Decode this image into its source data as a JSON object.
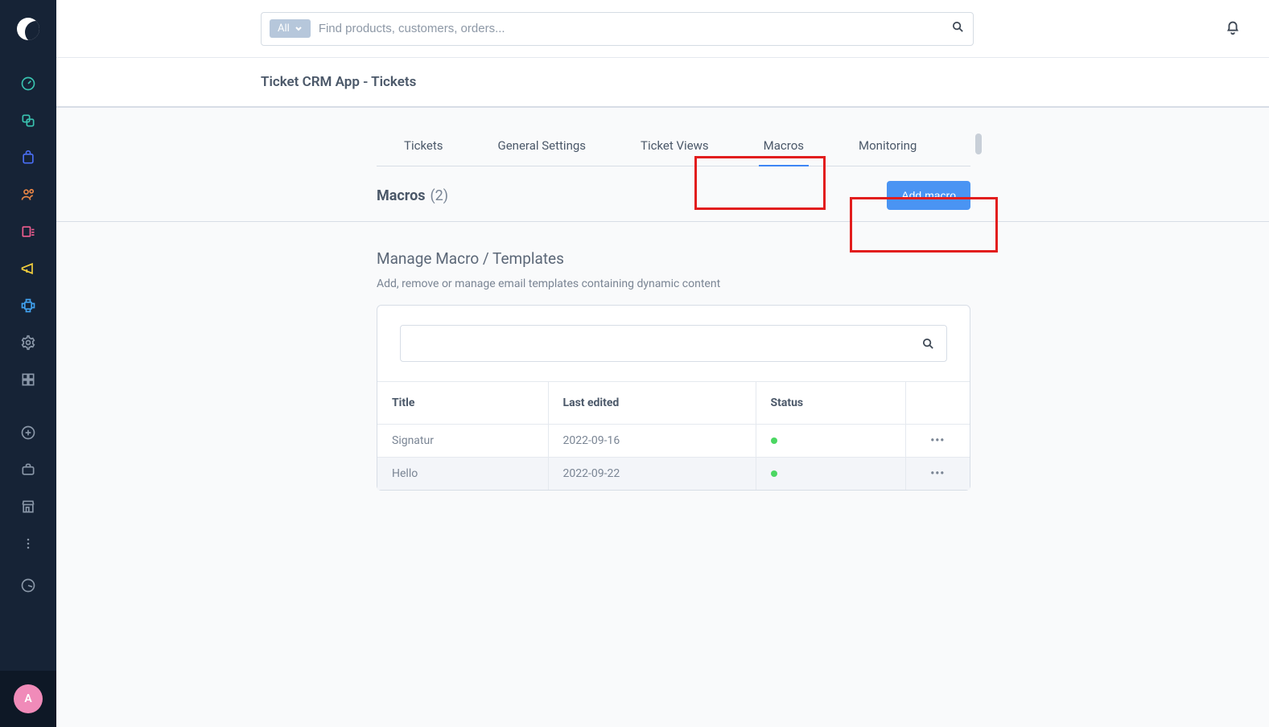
{
  "search": {
    "filter_label": "All",
    "placeholder": "Find products, customers, orders..."
  },
  "page_title": "Ticket CRM App - Tickets",
  "tabs": {
    "items": [
      {
        "label": "Tickets"
      },
      {
        "label": "General Settings"
      },
      {
        "label": "Ticket Views"
      },
      {
        "label": "Macros"
      },
      {
        "label": "Monitoring"
      }
    ],
    "active_index": 3
  },
  "subheader": {
    "title": "Macros",
    "count": "(2)",
    "add_button": "Add macro"
  },
  "section": {
    "title": "Manage Macro / Templates",
    "subtitle": "Add, remove or manage email templates containing dynamic content"
  },
  "table": {
    "columns": {
      "title": "Title",
      "last_edited": "Last edited",
      "status": "Status"
    },
    "rows": [
      {
        "title": "Signatur",
        "last_edited": "2022-09-16",
        "status": "active"
      },
      {
        "title": "Hello",
        "last_edited": "2022-09-22",
        "status": "active"
      }
    ]
  },
  "avatar_letter": "A",
  "sidebar_icons": [
    "dashboard-icon",
    "catalog-icon",
    "orders-icon",
    "customers-icon",
    "content-icon",
    "marketing-icon",
    "extensions-icon",
    "settings-icon",
    "apps-icon",
    "add-icon",
    "briefcase-icon",
    "store-icon",
    "more-icon"
  ],
  "icon_colors": {
    "dashboard-icon": "#39c3b0",
    "catalog-icon": "#39c3b0",
    "orders-icon": "#4a6ef5",
    "customers-icon": "#e88545",
    "content-icon": "#ef5d8f",
    "marketing-icon": "#f3cf3d",
    "extensions-icon": "#41a2f0",
    "settings-icon": "#8a97a8",
    "apps-icon": "#8a97a8",
    "add-icon": "#8a97a8",
    "briefcase-icon": "#8a97a8",
    "store-icon": "#8a97a8",
    "more-icon": "#8a97a8"
  }
}
